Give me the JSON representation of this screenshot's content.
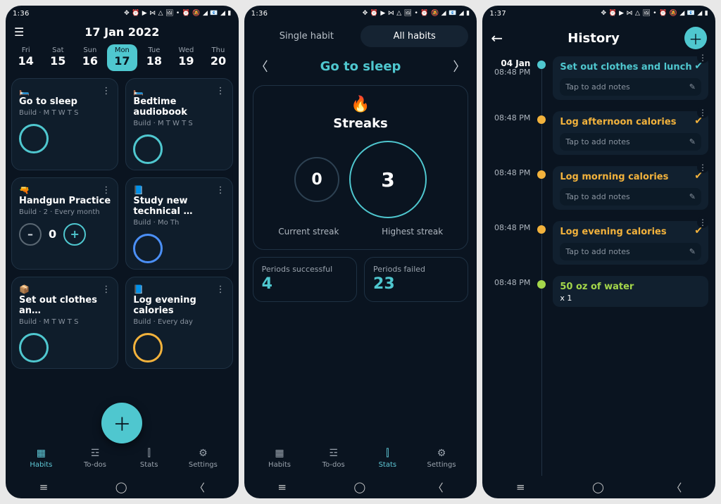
{
  "statusbar": {
    "time1": "1:36",
    "time3": "1:37",
    "icons": "✥ ⏰ ▶ ⋈ △ 🖼  •  ⏰ 🔕 ◢ 📧 ◢ ▮"
  },
  "screen1": {
    "title": "17 Jan 2022",
    "days": [
      {
        "dow": "Fri",
        "num": "14"
      },
      {
        "dow": "Sat",
        "num": "15"
      },
      {
        "dow": "Sun",
        "num": "16"
      },
      {
        "dow": "Mon",
        "num": "17",
        "selected": true
      },
      {
        "dow": "Tue",
        "num": "18"
      },
      {
        "dow": "Wed",
        "num": "19"
      },
      {
        "dow": "Thu",
        "num": "20"
      }
    ],
    "cards": [
      {
        "emoji": "🛏️",
        "name": "Go to sleep",
        "meta": "Build · M T W T S",
        "ring": "teal"
      },
      {
        "emoji": "🛏️",
        "name": "Bedtime audiobook",
        "meta": "Build · M T W T S",
        "ring": "teal"
      },
      {
        "emoji": "🔫",
        "name": "Handgun Practice",
        "meta": "Build · 2 · Every month",
        "counter": "0"
      },
      {
        "emoji": "📘",
        "name": "Study new technical …",
        "meta": "Build · Mo Th",
        "ring": "blue"
      },
      {
        "emoji": "📦",
        "name": "Set out clothes an…",
        "meta": "Build · M T W T S",
        "ring": "teal"
      },
      {
        "emoji": "📘",
        "name": "Log evening calories",
        "meta": "Build · Every day",
        "ring": "amber"
      }
    ],
    "tabs": {
      "habits": "Habits",
      "todos": "To-dos",
      "stats": "Stats",
      "settings": "Settings"
    }
  },
  "screen2": {
    "tab_single": "Single habit",
    "tab_all": "All habits",
    "habit_name": "Go to sleep",
    "streaks_title": "Streaks",
    "current_streak": "0",
    "highest_streak": "3",
    "lbl_current": "Current streak",
    "lbl_highest": "Highest streak",
    "periods_success_lbl": "Periods successful",
    "periods_success_val": "4",
    "periods_fail_lbl": "Periods failed",
    "periods_fail_val": "23"
  },
  "screen3": {
    "title": "History",
    "items": [
      {
        "date": "04 Jan",
        "time": "08:48 PM",
        "name": "Set out clothes and lunch",
        "notes": "Tap to add notes",
        "color": "#4fc7cf"
      },
      {
        "time": "08:48 PM",
        "name": "Log afternoon calories",
        "notes": "Tap to add notes",
        "color": "#f2b23c"
      },
      {
        "time": "08:48 PM",
        "name": "Log morning calories",
        "notes": "Tap to add notes",
        "color": "#f2b23c"
      },
      {
        "time": "08:48 PM",
        "name": "Log evening calories",
        "notes": "Tap to add notes",
        "color": "#f2b23c"
      },
      {
        "time": "08:48 PM",
        "name": "50 oz of water",
        "sub": "x 1",
        "color": "#a4d64a"
      }
    ]
  }
}
